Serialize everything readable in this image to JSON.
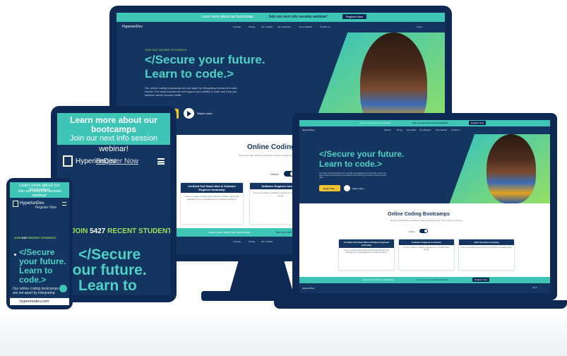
{
  "brand": {
    "name": "HyperionDev",
    "colors": {
      "navy": "#14355f",
      "teal": "#3ec5b6",
      "green": "#9be15d",
      "yellow": "#f2c12e"
    }
  },
  "top_banner": {
    "text": "Learn more about our bootcamps",
    "text2": "Join our next info session webinar!",
    "cta": "Register Now"
  },
  "nav": {
    "items": [
      "Courses",
      "Pricing",
      "Our method",
      "For employers",
      "Join a webinar",
      "Contact us"
    ],
    "login": "Log in"
  },
  "hero": {
    "kicker_pre": "JOIN",
    "kicker_count": "5427",
    "kicker_post": "RECENT STUDENTS",
    "headline_line1": "</Secure your future.",
    "headline_line2": "Learn to code.>",
    "body": "Our online coding bootcamps are set apart by integrating human-led code review. Our deep experience will support your ability to code and help you achieve career-focused skills.",
    "cta": "Begin Trial",
    "watch": "Watch video"
  },
  "section": {
    "title": "Online Coding Bootcamps",
    "subtitle": "We partner with leading universities to deliver coding bootcamps. Study online or on campus.",
    "toggle_label": "Online"
  },
  "cards": [
    {
      "title": "Certified Full Stack Web & Software Engineer bootcamp",
      "body": "Learn to create complex and powerful software, apps and websites in our most advanced immersive bootcamp."
    },
    {
      "title": "Software Engineer bootcamp",
      "body": "Go from newbie to software engineer in our comprehensive course."
    },
    {
      "title": "Data Scientist bootcamp",
      "body": "Learn to use Data Science to help you interpret and analyse data."
    }
  ],
  "footer_bar": {
    "text": "Learn more about our bootcamps",
    "text2": "Join our next info session webinar!",
    "cta": "Register Now"
  },
  "phone": {
    "headline_line1": "</Secure",
    "headline_line2": "your future.",
    "headline_line3": "Learn to",
    "headline_line4": "code.>",
    "body": "Our online coding bootcamps are set apart by integrating",
    "url": "hyperiondev.com"
  },
  "tablet": {
    "banner_line1": "Learn more about our",
    "banner_line2": "bootcamps",
    "banner_line3": "Join our next info session",
    "banner_line4": "webinar!",
    "cta": "Register Now",
    "headline_line1": "</Secure",
    "headline_line2": "your future.",
    "headline_line3": "Learn to"
  }
}
